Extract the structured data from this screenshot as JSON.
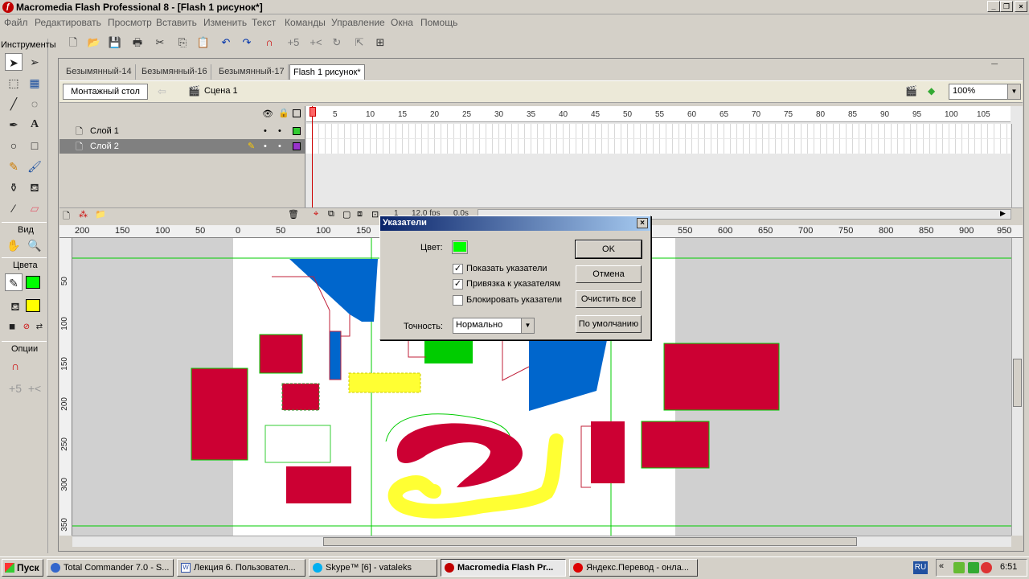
{
  "window": {
    "title": "Macromedia Flash Professional 8 - [Flash 1 рисунок*]"
  },
  "menu": [
    "Файл",
    "Редактировать",
    "Просмотр",
    "Вставить",
    "Изменить",
    "Текст",
    "Команды",
    "Управление",
    "Окна",
    "Помощь"
  ],
  "tools_panel": {
    "title": "Инструменты",
    "view_label": "Вид",
    "colors_label": "Цвета",
    "options_label": "Опции",
    "stroke_color": "#00ff00",
    "fill_color": "#ffff00"
  },
  "doc_tabs": [
    "Безымянный-14",
    "Безымянный-16",
    "Безымянный-17",
    "Flash 1 рисунок*"
  ],
  "edit_bar": {
    "stage_button": "Монтажный стол",
    "scene_label": "Сцена 1",
    "zoom": "100%"
  },
  "timeline": {
    "frame_numbers": [
      "5",
      "10",
      "15",
      "20",
      "25",
      "30",
      "35",
      "40",
      "45",
      "50",
      "55",
      "60",
      "65",
      "70",
      "75",
      "80",
      "85",
      "90",
      "95",
      "100",
      "105"
    ],
    "layers": [
      {
        "name": "Слой 1",
        "outline_color": "#33cc33",
        "selected": false
      },
      {
        "name": "Слой 2",
        "outline_color": "#9933cc",
        "selected": true
      }
    ],
    "current_frame": "1",
    "fps": "12.0 fps",
    "time": "0.0s"
  },
  "rulers": {
    "horizontal": [
      "200",
      "150",
      "100",
      "50",
      "0",
      "50",
      "100",
      "150",
      "550",
      "600",
      "650",
      "700",
      "750",
      "800",
      "850",
      "900",
      "950"
    ],
    "vertical": [
      "50",
      "100",
      "150",
      "200",
      "250",
      "300",
      "350"
    ]
  },
  "dialog": {
    "title": "Указатели",
    "color_label": "Цвет:",
    "color_value": "#00ff00",
    "checkboxes": [
      {
        "label": "Показать указатели",
        "checked": true
      },
      {
        "label": "Привязка к указателям",
        "checked": true
      },
      {
        "label": "Блокировать указатели",
        "checked": false
      }
    ],
    "accuracy_label": "Точность:",
    "accuracy_value": "Нормально",
    "buttons": {
      "ok": "OK",
      "cancel": "Отмена",
      "clear_all": "Очистить все",
      "default": "По умолчанию"
    }
  },
  "taskbar": {
    "start": "Пуск",
    "tasks": [
      {
        "label": "Total Commander 7.0 - S...",
        "active": false
      },
      {
        "label": "Лекция 6. Пользовател...",
        "active": false
      },
      {
        "label": "Skype™ [6] - vataleks",
        "active": false
      },
      {
        "label": "Macromedia Flash Pr...",
        "active": true
      },
      {
        "label": "Яндекс.Перевод - онла...",
        "active": false
      }
    ],
    "lang": "RU",
    "clock": "6:51"
  }
}
